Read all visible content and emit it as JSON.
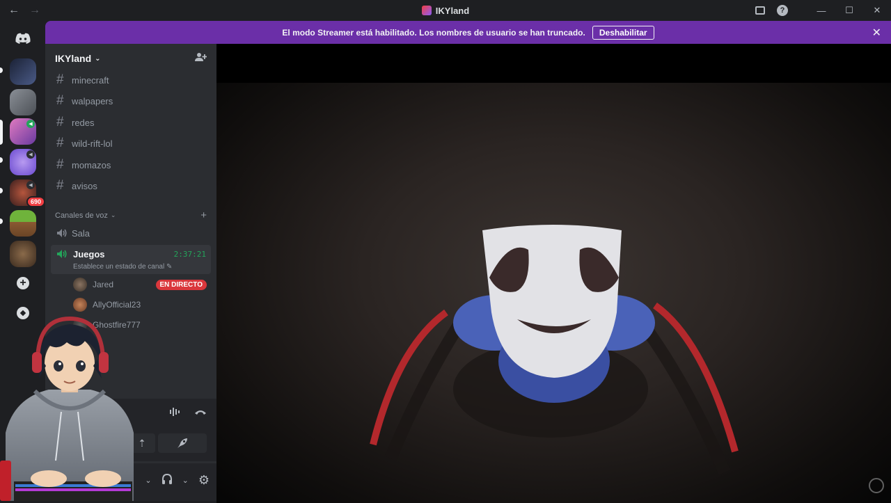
{
  "window": {
    "title": "IKYland"
  },
  "banner": {
    "message": "El modo Streamer está habilitado. Los nombres de usuario se han truncado.",
    "button_label": "Deshabilitar"
  },
  "rail": {
    "servers": [
      {
        "name": "server-1",
        "color": "#2e3a5a"
      },
      {
        "name": "server-2",
        "color": "#6b6f76"
      },
      {
        "name": "server-3",
        "color": "#b04a9e",
        "badge_voice": true
      },
      {
        "name": "server-4",
        "color": "#7b5cd6",
        "badge_voice": true
      },
      {
        "name": "server-5",
        "color": "#8a3a3a",
        "badge": "690"
      },
      {
        "name": "server-6",
        "color": "#6aa23a"
      },
      {
        "name": "server-7",
        "color": "#6b5140"
      }
    ]
  },
  "sidebar": {
    "guild_name": "IKYland",
    "text_channels": [
      "minecraft",
      "walpapers",
      "redes",
      "wild-rift-lol",
      "momazos",
      "avisos"
    ],
    "voice_category": "Canales de voz",
    "voice_channels": {
      "idle": "Sala",
      "active": {
        "name": "Juegos",
        "timer": "2:37:21",
        "status": "Establece un estado de canal"
      }
    },
    "voice_users": [
      {
        "name": "Jared",
        "live": "EN DIRECTO",
        "color": "#5a4b42"
      },
      {
        "name": "AllyOfficial23",
        "color": "#8a5a40"
      },
      {
        "name": "Ghostfire777",
        "color": "#3a3a3a"
      }
    ]
  },
  "colors": {
    "banner": "#6b2fa8",
    "live_badge": "#da373c",
    "voice_connected": "#23a55a"
  }
}
